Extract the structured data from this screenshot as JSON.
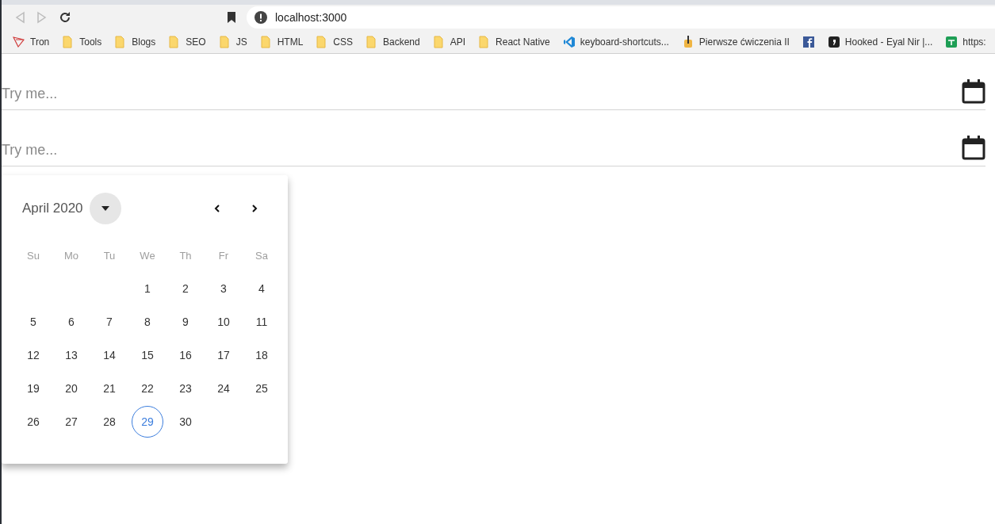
{
  "browser": {
    "address": "localhost:3000",
    "bookmarks": [
      {
        "kind": "tron",
        "label": "Tron"
      },
      {
        "kind": "folder",
        "label": "Tools"
      },
      {
        "kind": "folder",
        "label": "Blogs"
      },
      {
        "kind": "folder",
        "label": "SEO"
      },
      {
        "kind": "folder",
        "label": "JS"
      },
      {
        "kind": "folder",
        "label": "HTML"
      },
      {
        "kind": "folder",
        "label": "CSS"
      },
      {
        "kind": "folder",
        "label": "Backend"
      },
      {
        "kind": "folder",
        "label": "API"
      },
      {
        "kind": "folder",
        "label": "React Native"
      },
      {
        "kind": "vscode",
        "label": "keyboard-shortcuts..."
      },
      {
        "kind": "app",
        "label": "Pierwsze ćwiczenia II"
      },
      {
        "kind": "facebook"
      },
      {
        "kind": "hooked",
        "label": "Hooked - Eyal Nir |..."
      },
      {
        "kind": "sheets",
        "label": "https:"
      }
    ]
  },
  "fields": [
    {
      "placeholder": "Try me..."
    },
    {
      "placeholder": "Try me..."
    }
  ],
  "calendar": {
    "month": "April 2020",
    "weekdays": [
      "Su",
      "Mo",
      "Tu",
      "We",
      "Th",
      "Fr",
      "Sa"
    ],
    "weeks": [
      [
        {
          "day": "1",
          "today": false
        },
        {
          "day": "2",
          "today": false
        },
        {
          "day": "3",
          "today": false
        },
        {
          "day": "4",
          "today": false
        }
      ],
      [
        {
          "day": "5",
          "today": false
        },
        {
          "day": "6",
          "today": false
        },
        {
          "day": "7",
          "today": false
        },
        {
          "day": "8",
          "today": false
        },
        {
          "day": "9",
          "today": false
        },
        {
          "day": "10",
          "today": false
        },
        {
          "day": "11",
          "today": false
        }
      ],
      [
        {
          "day": "12",
          "today": false
        },
        {
          "day": "13",
          "today": false
        },
        {
          "day": "14",
          "today": false
        },
        {
          "day": "15",
          "today": false
        },
        {
          "day": "16",
          "today": false
        },
        {
          "day": "17",
          "today": false
        },
        {
          "day": "18",
          "today": false
        }
      ],
      [
        {
          "day": "19",
          "today": false
        },
        {
          "day": "20",
          "today": false
        },
        {
          "day": "21",
          "today": false
        },
        {
          "day": "22",
          "today": false
        },
        {
          "day": "23",
          "today": false
        },
        {
          "day": "24",
          "today": false
        },
        {
          "day": "25",
          "today": false
        }
      ],
      [
        {
          "day": "26",
          "today": false
        },
        {
          "day": "27",
          "today": false
        },
        {
          "day": "28",
          "today": false
        },
        {
          "day": "29",
          "today": true
        },
        {
          "day": "30",
          "today": false
        }
      ]
    ]
  }
}
